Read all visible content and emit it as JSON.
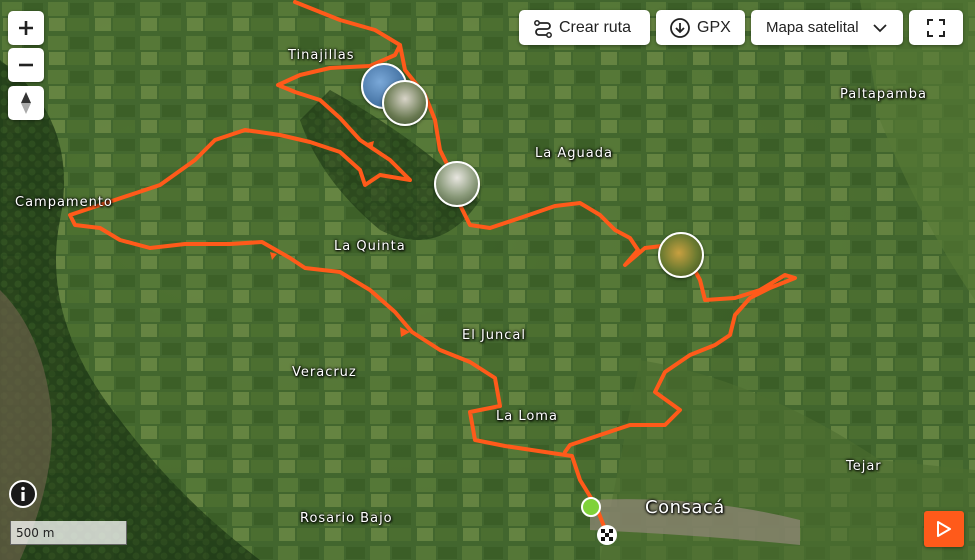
{
  "map": {
    "type": "satellite",
    "places": [
      {
        "name": "Tinajillas"
      },
      {
        "name": "Paltapamba"
      },
      {
        "name": "La Aguada"
      },
      {
        "name": "Campamento"
      },
      {
        "name": "La Quinta"
      },
      {
        "name": "El Juncal"
      },
      {
        "name": "Veracruz"
      },
      {
        "name": "La Loma"
      },
      {
        "name": "Tejar"
      },
      {
        "name": "Consacá"
      },
      {
        "name": "Rosario Bajo"
      }
    ],
    "route_color": "#ff5a1a"
  },
  "toolbar": {
    "create_route": "Crear ruta",
    "gpx": "GPX",
    "map_type": "Mapa satelital"
  },
  "scale": {
    "label": "500 m"
  },
  "icons": {
    "zoom_in": "plus-icon",
    "zoom_out": "minus-icon",
    "compass": "compass-icon",
    "fullscreen": "fullscreen-icon",
    "info": "info-icon",
    "play": "play-icon",
    "start": "start-marker",
    "finish": "finish-flag-marker"
  }
}
